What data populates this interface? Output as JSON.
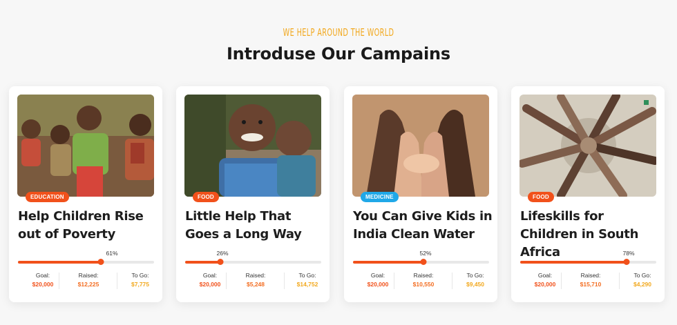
{
  "header": {
    "eyebrow": "WE HELP AROUND THE WORLD",
    "title": "Introduse Our Campains"
  },
  "colors": {
    "accent": "#f1511b",
    "eyebrow": "#f2a81d",
    "goal_value": "#f1511b",
    "raised_value": "#f36d21",
    "togo_value": "#f2a81d",
    "tag_education": "#f1511b",
    "tag_food": "#f1511b",
    "tag_medicine": "#20a8e8"
  },
  "campaigns": [
    {
      "tag": "EDUCATION",
      "tag_color": "#f1511b",
      "image": "children-group-photo",
      "title": "Help Children Rise out of Poverty",
      "progress_label": "61%",
      "progress": 0.61,
      "goal_label": "Goal:",
      "goal_value": "$20,000",
      "raised_label": "Raised:",
      "raised_value": "$12,225",
      "togo_label": "To Go:",
      "togo_value": "$7,775"
    },
    {
      "tag": "FOOD",
      "tag_color": "#f1511b",
      "image": "smiling-boys-photo",
      "title": "Little Help That Goes a Long Way",
      "progress_label": "26%",
      "progress": 0.26,
      "goal_label": "Goal:",
      "goal_value": "$20,000",
      "raised_label": "Raised:",
      "raised_value": "$5,248",
      "togo_label": "To Go:",
      "togo_value": "$14,752"
    },
    {
      "tag": "MEDICINE",
      "tag_color": "#20a8e8",
      "image": "cupped-hands-photo",
      "title": "You Can Give Kids in India Clean Water",
      "progress_label": "52%",
      "progress": 0.52,
      "goal_label": "Goal:",
      "goal_value": "$20,000",
      "raised_label": "Raised:",
      "raised_value": "$10,550",
      "togo_label": "To Go:",
      "togo_value": "$9,450"
    },
    {
      "tag": "FOOD",
      "tag_color": "#f1511b",
      "image": "hands-circle-photo",
      "title": "Lifeskills for Children in South Africa",
      "progress_label": "78%",
      "progress": 0.78,
      "goal_label": "Goal:",
      "goal_value": "$20,000",
      "raised_label": "Raised:",
      "raised_value": "$15,710",
      "togo_label": "To Go:",
      "togo_value": "$4,290"
    }
  ]
}
